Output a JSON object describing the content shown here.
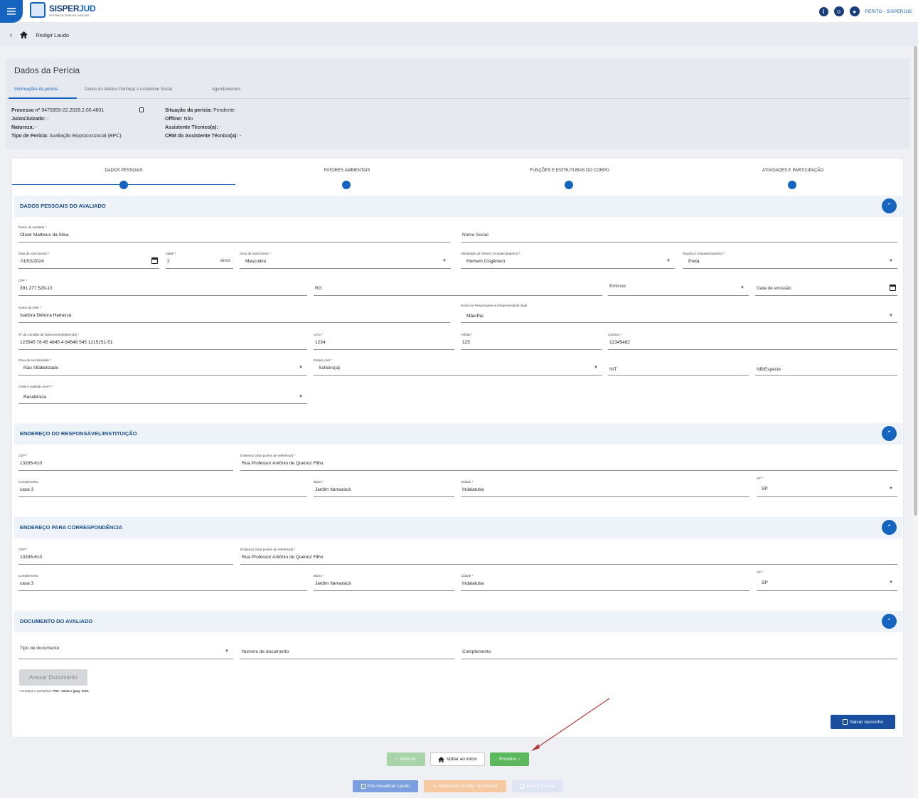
{
  "header": {
    "app_name_a": "SISPER",
    "app_name_b": "JUD",
    "app_subtitle": "SISTEMA DE PERÍCIAS JUDICIAIS",
    "user": "PERITO - SISPERJUD"
  },
  "breadcrumb": {
    "page": "Redigir Laudo"
  },
  "pericia": {
    "title": "Dados da Perícia",
    "tabs": [
      "Informações da perícia",
      "Dados do Médico Perito(a) e Assistente Social",
      "Agendamentos"
    ],
    "left": [
      {
        "k": "Processo nº",
        "v": "9475959-22.2026.2.00.4801"
      },
      {
        "k": "Juízo/Juizado:",
        "v": "-"
      },
      {
        "k": "Natureza:",
        "v": "-"
      },
      {
        "k": "Tipo de Perícia:",
        "v": "Avaliação Biopsicossocial (BPC)"
      }
    ],
    "right": [
      {
        "k": "Situação da perícia:",
        "v": "Pendente"
      },
      {
        "k": "Offline:",
        "v": "Não"
      },
      {
        "k": "Assistente Técnico(a):",
        "v": "-"
      },
      {
        "k": "CRM do Assistente Técnico(a):",
        "v": "-"
      }
    ]
  },
  "steps": [
    "DADOS PESSOAIS",
    "FATORES AMBIENTAIS",
    "FUNÇÕES E ESTRUTURAS DO CORPO",
    "ATIVIDADES E PARTICIPAÇÃO"
  ],
  "sections": {
    "pessoais": "DADOS PESSOAIS DO AVALIADO",
    "endereco_resp": "ENDEREÇO DO RESPONSÁVEL/INSTITUIÇÃO",
    "endereco_corr": "ENDEREÇO PARA CORRESPONDÊNCIA",
    "documento": "DOCUMENTO DO AVALIADO"
  },
  "fields": {
    "nome": {
      "label": "Nome do avaliado *",
      "value": "Oliver Matheus da Silva"
    },
    "nome_social": {
      "placeholder": "Nome Social"
    },
    "nascimento": {
      "label": "Data de nascimento *",
      "value": "01/02/2024"
    },
    "idade": {
      "label": "Idade *",
      "value": "2",
      "suffix": "anos"
    },
    "sexo": {
      "label": "Sexo de nascimento *",
      "value": "Masculino"
    },
    "genero": {
      "label": "Identidade de Gênero (Autodeclaratório) *",
      "value": "Homem Cisgênero"
    },
    "raca": {
      "label": "Raça/Cor (Autodeclaratório) *",
      "value": "Preta"
    },
    "cpf": {
      "label": "CPF *",
      "value": "391.277.528-10"
    },
    "rg": {
      "placeholder": "RG"
    },
    "emissor": {
      "placeholder": "Emissor"
    },
    "data_emissao": {
      "placeholder": "Data de emissão"
    },
    "mae": {
      "label": "Nome da mãe *",
      "value": "Isadora Débora Hadassa"
    },
    "responsavel": {
      "label": "Nome do Responsável ou Representante legal",
      "value": "Mãe/Pai"
    },
    "certidao": {
      "label": "Nº da Certidão de Nascimento(Matrícula) *",
      "value": "123545 78 45 4845 4 84548 545 1215151-51"
    },
    "livro": {
      "label": "Livro *",
      "value": "1234"
    },
    "folhas": {
      "label": "Folhas *",
      "value": "125"
    },
    "cartorio": {
      "label": "Cartório *",
      "value": "12345482"
    },
    "escolaridade": {
      "label": "Grau de escolaridade *",
      "value": "Não Alfabetizado"
    },
    "estado_civil": {
      "label": "Estado civil *",
      "value": "Solteiro(a)"
    },
    "nit": {
      "placeholder": "NIT"
    },
    "nb": {
      "placeholder": "NB/Espécie"
    },
    "onde_vive": {
      "label": "Onde o avaliado vive? *",
      "value": "Residência"
    }
  },
  "endereco": {
    "cep_label": "CEP *",
    "cep": "13335-610",
    "end_label": "Endereço (citar pontos de referência) *",
    "end": "Rua Professor Antônio de Queiroz Filho",
    "comp_label": "Complemento",
    "comp": "casa 3",
    "bairro_label": "Bairro *",
    "bairro": "Jardim Itamaracá",
    "cidade_label": "Cidade *",
    "cidade": "Indaiatuba",
    "uf_label": "UF *",
    "uf": "SP"
  },
  "documento": {
    "tipo": "Tipo de documento",
    "numero": "Número de documento",
    "complemento": "Complemento",
    "anexar": "Anexar Documento",
    "hint_prefix": "Formatos e tamanhos: ",
    "hint_bold": "PDF: 10mb e jpeg: 3mb."
  },
  "buttons": {
    "salvar": "Salvar rascunho",
    "anterior": "Anterior",
    "voltar": "Voltar ao início",
    "proximo": "Próximo",
    "previsualizar": "Pré-visualizar Laudo",
    "restaurar": "Restaurar Config. da Perícia",
    "enviar": "Enviar Perícia"
  },
  "colors": {
    "primary": "#1565c0",
    "success": "#5cb85c",
    "warning": "#f0ad4e"
  }
}
